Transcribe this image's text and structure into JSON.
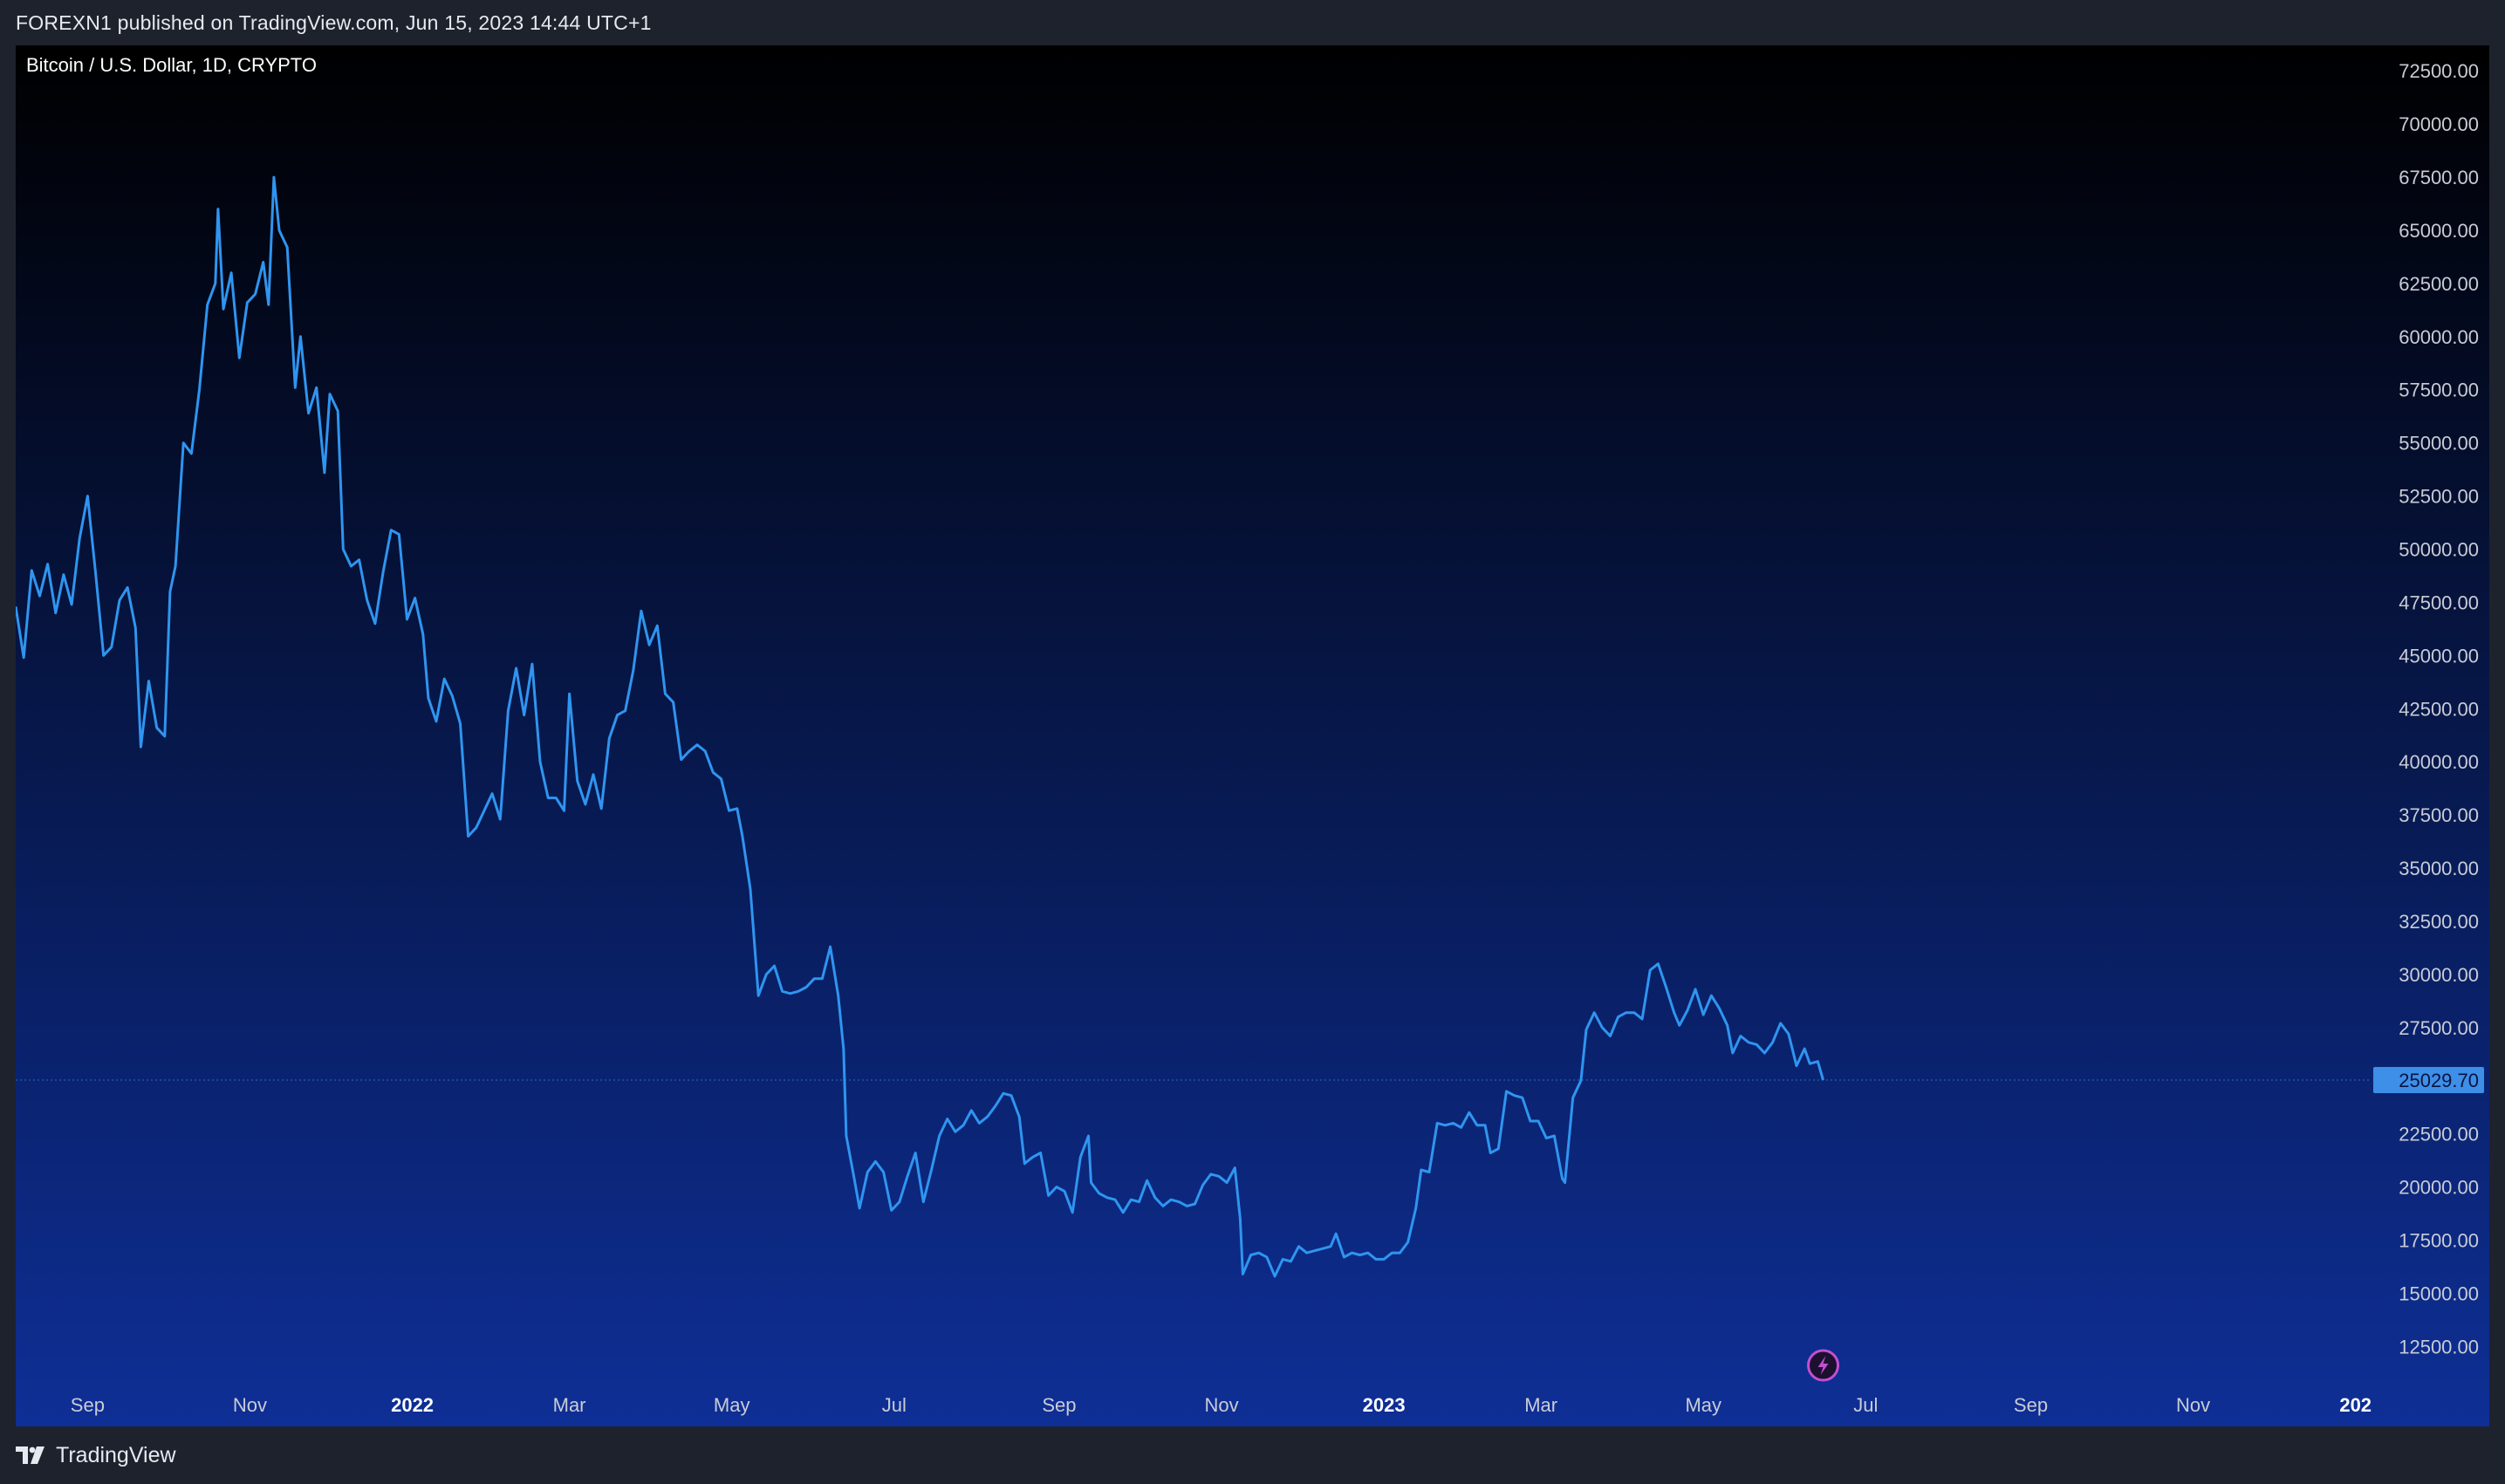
{
  "header": {
    "published_text": "FOREXN1 published on TradingView.com, Jun 15, 2023 14:44 UTC+1"
  },
  "footer": {
    "brand": "TradingView",
    "brand_icon": "tradingview-logo-icon"
  },
  "colors": {
    "line": "#2f95f0",
    "bg_top": "#000000",
    "bg_bottom": "#0e2f96",
    "axis_text": "#c9ccd6",
    "price_label_bg": "#3d8fe8",
    "price_label_text": "#0b1440",
    "alert_icon": "#c24fd0"
  },
  "chart_data": {
    "type": "line",
    "symbol": "Bitcoin / U.S. Dollar, 1D, CRYPTO",
    "ylim": [
      10500,
      73700
    ],
    "x_start": "2021-08-05",
    "x_end": "2024-01-07",
    "x_ticks": [
      {
        "label": "Sep",
        "date": "2021-09-01",
        "bold": false
      },
      {
        "label": "Nov",
        "date": "2021-11-01",
        "bold": false
      },
      {
        "label": "2022",
        "date": "2022-01-01",
        "bold": true
      },
      {
        "label": "Mar",
        "date": "2022-03-01",
        "bold": false
      },
      {
        "label": "May",
        "date": "2022-05-01",
        "bold": false
      },
      {
        "label": "Jul",
        "date": "2022-07-01",
        "bold": false
      },
      {
        "label": "Sep",
        "date": "2022-09-01",
        "bold": false
      },
      {
        "label": "Nov",
        "date": "2022-11-01",
        "bold": false
      },
      {
        "label": "2023",
        "date": "2023-01-01",
        "bold": true
      },
      {
        "label": "Mar",
        "date": "2023-03-01",
        "bold": false
      },
      {
        "label": "May",
        "date": "2023-05-01",
        "bold": false
      },
      {
        "label": "Jul",
        "date": "2023-07-01",
        "bold": false
      },
      {
        "label": "Sep",
        "date": "2023-09-01",
        "bold": false
      },
      {
        "label": "Nov",
        "date": "2023-11-01",
        "bold": false
      },
      {
        "label": "202",
        "date": "2024-01-01",
        "bold": true
      }
    ],
    "y_ticks": [
      "12500.00",
      "15000.00",
      "17500.00",
      "20000.00",
      "22500.00",
      "25000.00",
      "27500.00",
      "30000.00",
      "32500.00",
      "35000.00",
      "37500.00",
      "40000.00",
      "42500.00",
      "45000.00",
      "47500.00",
      "50000.00",
      "52500.00",
      "55000.00",
      "57500.00",
      "60000.00",
      "62500.00",
      "65000.00",
      "67500.00",
      "70000.00",
      "72500.00"
    ],
    "last_price": "25029.70",
    "series": [
      {
        "points": [
          [
            "2021-08-05",
            47300
          ],
          [
            "2021-08-08",
            44900
          ],
          [
            "2021-08-11",
            49000
          ],
          [
            "2021-08-14",
            47800
          ],
          [
            "2021-08-17",
            49300
          ],
          [
            "2021-08-20",
            47000
          ],
          [
            "2021-08-23",
            48800
          ],
          [
            "2021-08-26",
            47400
          ],
          [
            "2021-08-29",
            50500
          ],
          [
            "2021-09-01",
            52500
          ],
          [
            "2021-09-04",
            48900
          ],
          [
            "2021-09-07",
            45000
          ],
          [
            "2021-09-10",
            45400
          ],
          [
            "2021-09-13",
            47600
          ],
          [
            "2021-09-16",
            48200
          ],
          [
            "2021-09-19",
            46300
          ],
          [
            "2021-09-21",
            40700
          ],
          [
            "2021-09-24",
            43800
          ],
          [
            "2021-09-27",
            41600
          ],
          [
            "2021-09-30",
            41200
          ],
          [
            "2021-10-02",
            48000
          ],
          [
            "2021-10-04",
            49200
          ],
          [
            "2021-10-07",
            55000
          ],
          [
            "2021-10-10",
            54500
          ],
          [
            "2021-10-13",
            57500
          ],
          [
            "2021-10-16",
            61500
          ],
          [
            "2021-10-19",
            62500
          ],
          [
            "2021-10-20",
            66000
          ],
          [
            "2021-10-22",
            61300
          ],
          [
            "2021-10-25",
            63000
          ],
          [
            "2021-10-28",
            59000
          ],
          [
            "2021-10-31",
            61600
          ],
          [
            "2021-11-03",
            62000
          ],
          [
            "2021-11-06",
            63500
          ],
          [
            "2021-11-08",
            61500
          ],
          [
            "2021-11-10",
            67500
          ],
          [
            "2021-11-12",
            65000
          ],
          [
            "2021-11-15",
            64200
          ],
          [
            "2021-11-18",
            57600
          ],
          [
            "2021-11-20",
            60000
          ],
          [
            "2021-11-23",
            56400
          ],
          [
            "2021-11-26",
            57600
          ],
          [
            "2021-11-29",
            53600
          ],
          [
            "2021-12-01",
            57300
          ],
          [
            "2021-12-04",
            56500
          ],
          [
            "2021-12-06",
            50000
          ],
          [
            "2021-12-09",
            49200
          ],
          [
            "2021-12-12",
            49500
          ],
          [
            "2021-12-15",
            47600
          ],
          [
            "2021-12-18",
            46500
          ],
          [
            "2021-12-21",
            48900
          ],
          [
            "2021-12-24",
            50900
          ],
          [
            "2021-12-27",
            50700
          ],
          [
            "2021-12-30",
            46700
          ],
          [
            "2022-01-02",
            47700
          ],
          [
            "2022-01-05",
            46000
          ],
          [
            "2022-01-07",
            43000
          ],
          [
            "2022-01-10",
            41900
          ],
          [
            "2022-01-13",
            43900
          ],
          [
            "2022-01-16",
            43100
          ],
          [
            "2022-01-19",
            41800
          ],
          [
            "2022-01-22",
            36500
          ],
          [
            "2022-01-25",
            36900
          ],
          [
            "2022-01-28",
            37700
          ],
          [
            "2022-01-31",
            38500
          ],
          [
            "2022-02-03",
            37300
          ],
          [
            "2022-02-06",
            42400
          ],
          [
            "2022-02-09",
            44400
          ],
          [
            "2022-02-12",
            42200
          ],
          [
            "2022-02-15",
            44600
          ],
          [
            "2022-02-18",
            40000
          ],
          [
            "2022-02-21",
            38300
          ],
          [
            "2022-02-24",
            38300
          ],
          [
            "2022-02-27",
            37700
          ],
          [
            "2022-03-01",
            43200
          ],
          [
            "2022-03-04",
            39100
          ],
          [
            "2022-03-07",
            38000
          ],
          [
            "2022-03-10",
            39400
          ],
          [
            "2022-03-13",
            37800
          ],
          [
            "2022-03-16",
            41100
          ],
          [
            "2022-03-19",
            42200
          ],
          [
            "2022-03-22",
            42400
          ],
          [
            "2022-03-25",
            44300
          ],
          [
            "2022-03-28",
            47100
          ],
          [
            "2022-03-31",
            45500
          ],
          [
            "2022-04-03",
            46400
          ],
          [
            "2022-04-06",
            43200
          ],
          [
            "2022-04-09",
            42800
          ],
          [
            "2022-04-12",
            40100
          ],
          [
            "2022-04-15",
            40500
          ],
          [
            "2022-04-18",
            40800
          ],
          [
            "2022-04-21",
            40500
          ],
          [
            "2022-04-24",
            39500
          ],
          [
            "2022-04-27",
            39200
          ],
          [
            "2022-04-30",
            37700
          ],
          [
            "2022-05-03",
            37800
          ],
          [
            "2022-05-05",
            36500
          ],
          [
            "2022-05-08",
            34000
          ],
          [
            "2022-05-11",
            29000
          ],
          [
            "2022-05-14",
            30000
          ],
          [
            "2022-05-17",
            30400
          ],
          [
            "2022-05-20",
            29200
          ],
          [
            "2022-05-23",
            29100
          ],
          [
            "2022-05-26",
            29200
          ],
          [
            "2022-05-29",
            29400
          ],
          [
            "2022-06-01",
            29800
          ],
          [
            "2022-06-04",
            29800
          ],
          [
            "2022-06-07",
            31300
          ],
          [
            "2022-06-10",
            29000
          ],
          [
            "2022-06-12",
            26500
          ],
          [
            "2022-06-13",
            22400
          ],
          [
            "2022-06-16",
            20400
          ],
          [
            "2022-06-18",
            19000
          ],
          [
            "2022-06-21",
            20700
          ],
          [
            "2022-06-24",
            21200
          ],
          [
            "2022-06-27",
            20700
          ],
          [
            "2022-06-30",
            18900
          ],
          [
            "2022-07-03",
            19300
          ],
          [
            "2022-07-06",
            20500
          ],
          [
            "2022-07-09",
            21600
          ],
          [
            "2022-07-12",
            19300
          ],
          [
            "2022-07-15",
            20800
          ],
          [
            "2022-07-18",
            22400
          ],
          [
            "2022-07-21",
            23200
          ],
          [
            "2022-07-24",
            22600
          ],
          [
            "2022-07-27",
            22900
          ],
          [
            "2022-07-30",
            23600
          ],
          [
            "2022-08-02",
            23000
          ],
          [
            "2022-08-05",
            23300
          ],
          [
            "2022-08-08",
            23800
          ],
          [
            "2022-08-11",
            24400
          ],
          [
            "2022-08-14",
            24300
          ],
          [
            "2022-08-17",
            23300
          ],
          [
            "2022-08-19",
            21100
          ],
          [
            "2022-08-22",
            21400
          ],
          [
            "2022-08-25",
            21600
          ],
          [
            "2022-08-28",
            19600
          ],
          [
            "2022-08-31",
            20000
          ],
          [
            "2022-09-03",
            19800
          ],
          [
            "2022-09-06",
            18800
          ],
          [
            "2022-09-09",
            21400
          ],
          [
            "2022-09-12",
            22400
          ],
          [
            "2022-09-13",
            20200
          ],
          [
            "2022-09-16",
            19700
          ],
          [
            "2022-09-19",
            19500
          ],
          [
            "2022-09-22",
            19400
          ],
          [
            "2022-09-25",
            18800
          ],
          [
            "2022-09-28",
            19400
          ],
          [
            "2022-10-01",
            19300
          ],
          [
            "2022-10-04",
            20300
          ],
          [
            "2022-10-07",
            19500
          ],
          [
            "2022-10-10",
            19100
          ],
          [
            "2022-10-13",
            19400
          ],
          [
            "2022-10-16",
            19300
          ],
          [
            "2022-10-19",
            19100
          ],
          [
            "2022-10-22",
            19200
          ],
          [
            "2022-10-25",
            20100
          ],
          [
            "2022-10-28",
            20600
          ],
          [
            "2022-10-31",
            20500
          ],
          [
            "2022-11-03",
            20200
          ],
          [
            "2022-11-06",
            20900
          ],
          [
            "2022-11-08",
            18500
          ],
          [
            "2022-11-09",
            15900
          ],
          [
            "2022-11-12",
            16800
          ],
          [
            "2022-11-15",
            16900
          ],
          [
            "2022-11-18",
            16700
          ],
          [
            "2022-11-21",
            15800
          ],
          [
            "2022-11-24",
            16600
          ],
          [
            "2022-11-27",
            16500
          ],
          [
            "2022-11-30",
            17200
          ],
          [
            "2022-12-03",
            16900
          ],
          [
            "2022-12-06",
            17000
          ],
          [
            "2022-12-09",
            17100
          ],
          [
            "2022-12-12",
            17200
          ],
          [
            "2022-12-14",
            17800
          ],
          [
            "2022-12-17",
            16700
          ],
          [
            "2022-12-20",
            16900
          ],
          [
            "2022-12-23",
            16800
          ],
          [
            "2022-12-26",
            16900
          ],
          [
            "2022-12-29",
            16600
          ],
          [
            "2023-01-01",
            16600
          ],
          [
            "2023-01-04",
            16900
          ],
          [
            "2023-01-07",
            16900
          ],
          [
            "2023-01-10",
            17400
          ],
          [
            "2023-01-13",
            19000
          ],
          [
            "2023-01-15",
            20800
          ],
          [
            "2023-01-18",
            20700
          ],
          [
            "2023-01-21",
            23000
          ],
          [
            "2023-01-24",
            22900
          ],
          [
            "2023-01-27",
            23000
          ],
          [
            "2023-01-30",
            22800
          ],
          [
            "2023-02-02",
            23500
          ],
          [
            "2023-02-05",
            22900
          ],
          [
            "2023-02-08",
            22900
          ],
          [
            "2023-02-10",
            21600
          ],
          [
            "2023-02-13",
            21800
          ],
          [
            "2023-02-16",
            24500
          ],
          [
            "2023-02-19",
            24300
          ],
          [
            "2023-02-22",
            24200
          ],
          [
            "2023-02-25",
            23100
          ],
          [
            "2023-02-28",
            23100
          ],
          [
            "2023-03-03",
            22300
          ],
          [
            "2023-03-06",
            22400
          ],
          [
            "2023-03-09",
            20400
          ],
          [
            "2023-03-10",
            20200
          ],
          [
            "2023-03-13",
            24200
          ],
          [
            "2023-03-16",
            25000
          ],
          [
            "2023-03-18",
            27400
          ],
          [
            "2023-03-21",
            28200
          ],
          [
            "2023-03-24",
            27500
          ],
          [
            "2023-03-27",
            27100
          ],
          [
            "2023-03-30",
            28000
          ],
          [
            "2023-04-02",
            28200
          ],
          [
            "2023-04-05",
            28200
          ],
          [
            "2023-04-08",
            27900
          ],
          [
            "2023-04-11",
            30200
          ],
          [
            "2023-04-14",
            30500
          ],
          [
            "2023-04-17",
            29400
          ],
          [
            "2023-04-20",
            28200
          ],
          [
            "2023-04-22",
            27600
          ],
          [
            "2023-04-25",
            28300
          ],
          [
            "2023-04-28",
            29300
          ],
          [
            "2023-05-01",
            28100
          ],
          [
            "2023-05-04",
            29000
          ],
          [
            "2023-05-07",
            28400
          ],
          [
            "2023-05-10",
            27600
          ],
          [
            "2023-05-12",
            26300
          ],
          [
            "2023-05-15",
            27100
          ],
          [
            "2023-05-18",
            26800
          ],
          [
            "2023-05-21",
            26700
          ],
          [
            "2023-05-24",
            26300
          ],
          [
            "2023-05-27",
            26800
          ],
          [
            "2023-05-30",
            27700
          ],
          [
            "2023-06-02",
            27200
          ],
          [
            "2023-06-05",
            25700
          ],
          [
            "2023-06-08",
            26500
          ],
          [
            "2023-06-10",
            25800
          ],
          [
            "2023-06-13",
            25900
          ],
          [
            "2023-06-15",
            25030
          ]
        ]
      }
    ]
  }
}
